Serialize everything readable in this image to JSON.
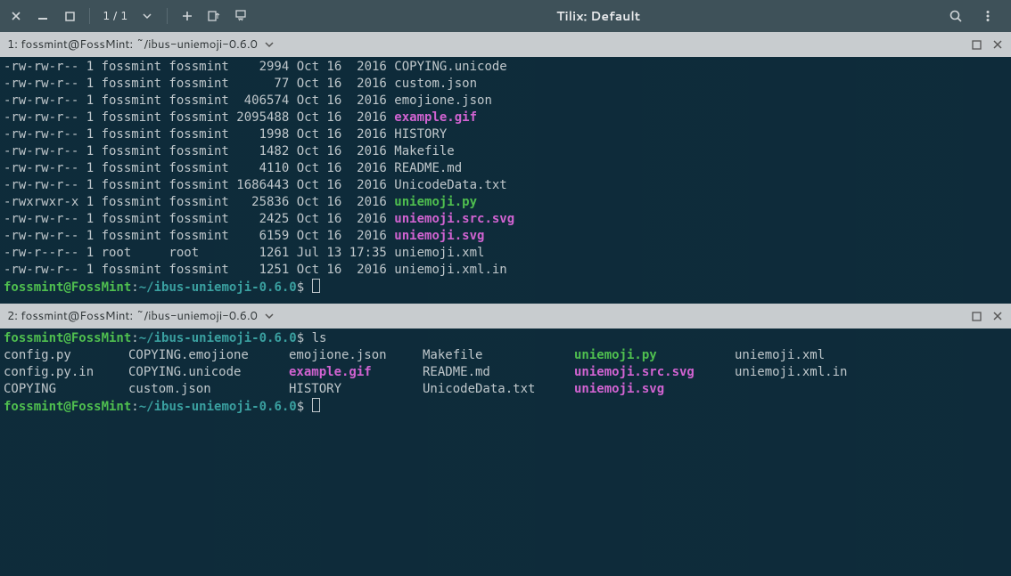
{
  "window": {
    "title": "Tilix: Default",
    "session_counter": "1 / 1"
  },
  "pane1": {
    "title": "1: fossmint@FossMint: ~/ibus-uniemoji-0.6.0",
    "listing": [
      {
        "perm": "-rw-rw-r--",
        "l": "1",
        "u": "fossmint",
        "g": "fossmint",
        "size": "   2994",
        "date": "Oct 16  2016",
        "name": "COPYING.unicode",
        "cls": "c-default"
      },
      {
        "perm": "-rw-rw-r--",
        "l": "1",
        "u": "fossmint",
        "g": "fossmint",
        "size": "     77",
        "date": "Oct 16  2016",
        "name": "custom.json",
        "cls": "c-default"
      },
      {
        "perm": "-rw-rw-r--",
        "l": "1",
        "u": "fossmint",
        "g": "fossmint",
        "size": " 406574",
        "date": "Oct 16  2016",
        "name": "emojione.json",
        "cls": "c-default"
      },
      {
        "perm": "-rw-rw-r--",
        "l": "1",
        "u": "fossmint",
        "g": "fossmint",
        "size": "2095488",
        "date": "Oct 16  2016",
        "name": "example.gif",
        "cls": "c-magenta"
      },
      {
        "perm": "-rw-rw-r--",
        "l": "1",
        "u": "fossmint",
        "g": "fossmint",
        "size": "   1998",
        "date": "Oct 16  2016",
        "name": "HISTORY",
        "cls": "c-default"
      },
      {
        "perm": "-rw-rw-r--",
        "l": "1",
        "u": "fossmint",
        "g": "fossmint",
        "size": "   1482",
        "date": "Oct 16  2016",
        "name": "Makefile",
        "cls": "c-default"
      },
      {
        "perm": "-rw-rw-r--",
        "l": "1",
        "u": "fossmint",
        "g": "fossmint",
        "size": "   4110",
        "date": "Oct 16  2016",
        "name": "README.md",
        "cls": "c-default"
      },
      {
        "perm": "-rw-rw-r--",
        "l": "1",
        "u": "fossmint",
        "g": "fossmint",
        "size": "1686443",
        "date": "Oct 16  2016",
        "name": "UnicodeData.txt",
        "cls": "c-default"
      },
      {
        "perm": "-rwxrwxr-x",
        "l": "1",
        "u": "fossmint",
        "g": "fossmint",
        "size": "  25836",
        "date": "Oct 16  2016",
        "name": "uniemoji.py",
        "cls": "c-green"
      },
      {
        "perm": "-rw-rw-r--",
        "l": "1",
        "u": "fossmint",
        "g": "fossmint",
        "size": "   2425",
        "date": "Oct 16  2016",
        "name": "uniemoji.src.svg",
        "cls": "c-magenta"
      },
      {
        "perm": "-rw-rw-r--",
        "l": "1",
        "u": "fossmint",
        "g": "fossmint",
        "size": "   6159",
        "date": "Oct 16  2016",
        "name": "uniemoji.svg",
        "cls": "c-magenta"
      },
      {
        "perm": "-rw-r--r--",
        "l": "1",
        "u": "root    ",
        "g": "root    ",
        "size": "   1261",
        "date": "Jul 13 17:35",
        "name": "uniemoji.xml",
        "cls": "c-default"
      },
      {
        "perm": "-rw-rw-r--",
        "l": "1",
        "u": "fossmint",
        "g": "fossmint",
        "size": "   1251",
        "date": "Oct 16  2016",
        "name": "uniemoji.xml.in",
        "cls": "c-default"
      }
    ],
    "prompt": {
      "user": "fossmint@FossMint",
      "sep": ":",
      "path": "~/ibus-uniemoji-0.6.0",
      "sym": "$"
    }
  },
  "pane2": {
    "title": "2: fossmint@FossMint: ~/ibus-uniemoji-0.6.0",
    "command": "ls",
    "grid": [
      [
        {
          "t": "config.py",
          "cls": "c-default"
        },
        {
          "t": "COPYING.emojione",
          "cls": "c-default"
        },
        {
          "t": "emojione.json",
          "cls": "c-default"
        },
        {
          "t": "Makefile",
          "cls": "c-default"
        },
        {
          "t": "uniemoji.py",
          "cls": "c-green"
        },
        {
          "t": "uniemoji.xml",
          "cls": "c-default"
        }
      ],
      [
        {
          "t": "config.py.in",
          "cls": "c-default"
        },
        {
          "t": "COPYING.unicode",
          "cls": "c-default"
        },
        {
          "t": "example.gif",
          "cls": "c-magenta"
        },
        {
          "t": "README.md",
          "cls": "c-default"
        },
        {
          "t": "uniemoji.src.svg",
          "cls": "c-magenta"
        },
        {
          "t": "uniemoji.xml.in",
          "cls": "c-default"
        }
      ],
      [
        {
          "t": "COPYING",
          "cls": "c-default"
        },
        {
          "t": "custom.json",
          "cls": "c-default"
        },
        {
          "t": "HISTORY",
          "cls": "c-default"
        },
        {
          "t": "UnicodeData.txt",
          "cls": "c-default"
        },
        {
          "t": "uniemoji.svg",
          "cls": "c-magenta"
        },
        {
          "t": "",
          "cls": "c-default"
        }
      ]
    ],
    "prompt": {
      "user": "fossmint@FossMint",
      "sep": ":",
      "path": "~/ibus-uniemoji-0.6.0",
      "sym": "$"
    }
  }
}
